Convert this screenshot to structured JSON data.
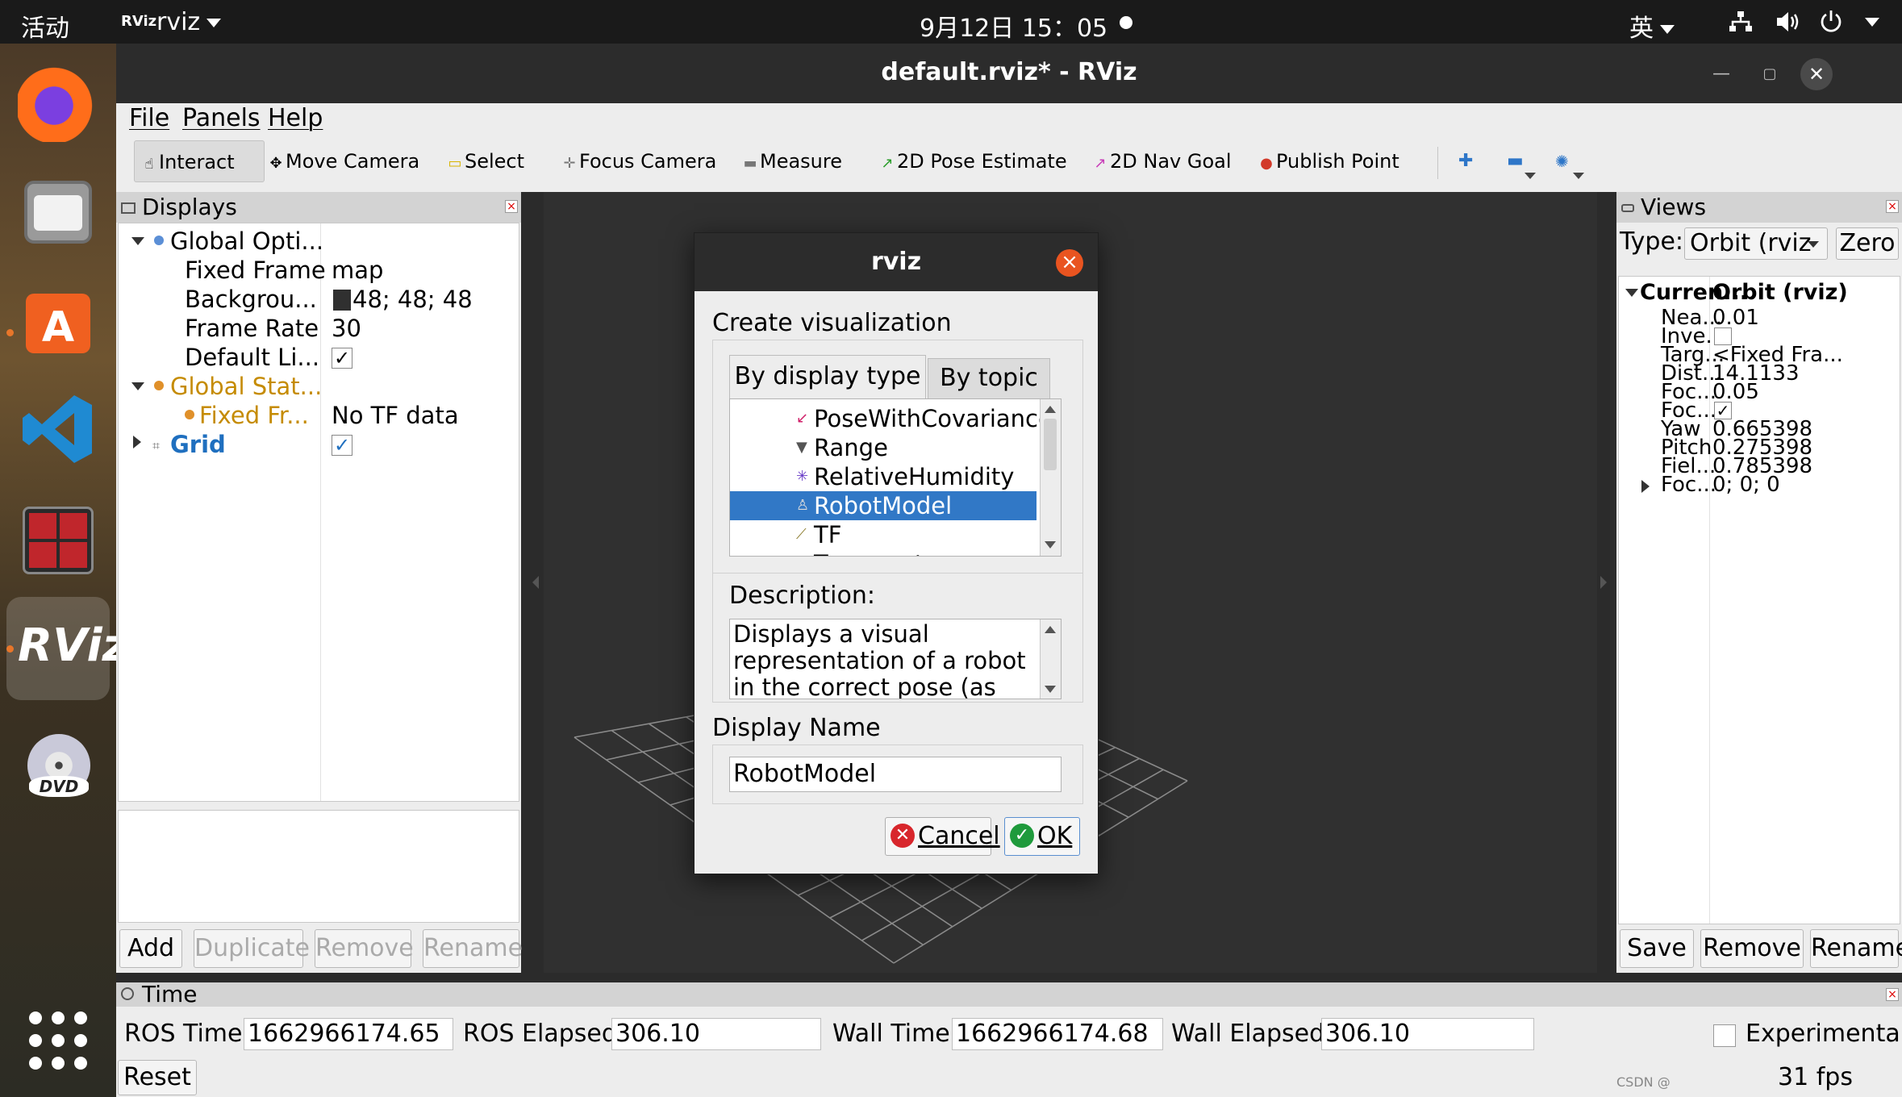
{
  "topbar": {
    "activities": "活动",
    "app_badge": "RViz",
    "app_name": "rviz",
    "clock": "9月12日 15：05",
    "input_method": "英"
  },
  "window": {
    "title": "default.rviz* - RViz"
  },
  "menu": {
    "file": "File",
    "panels": "Panels",
    "help": "Help"
  },
  "toolbar": {
    "interact": "Interact",
    "move_camera": "Move Camera",
    "select": "Select",
    "focus_camera": "Focus Camera",
    "measure": "Measure",
    "pose_estimate": "2D Pose Estimate",
    "nav_goal": "2D Nav Goal",
    "publish_point": "Publish Point"
  },
  "displays": {
    "title": "Displays",
    "global_options": "Global Opti...",
    "fixed_frame_label": "Fixed Frame",
    "fixed_frame_value": "map",
    "background_label": "Backgrou...",
    "background_value": "48; 48; 48",
    "frame_rate_label": "Frame Rate",
    "frame_rate_value": "30",
    "default_light_label": "Default Li...",
    "global_status": "Global Stat...",
    "fixed_fr_label": "Fixed Fr...",
    "fixed_fr_value": "No TF data",
    "grid": "Grid",
    "buttons": {
      "add": "Add",
      "duplicate": "Duplicate",
      "remove": "Remove",
      "rename": "Rename"
    },
    "colors": {
      "warning": "#c58b00",
      "link": "#1f6fbf"
    }
  },
  "views": {
    "title": "Views",
    "type_label": "Type:",
    "type_value": "Orbit (rviz",
    "zero": "Zero",
    "current_label": "Curren...",
    "current_value": "Orbit (rviz)",
    "rows": [
      {
        "k": "Nea...",
        "v": "0.01"
      },
      {
        "k": "Inve...",
        "v": ""
      },
      {
        "k": "Targ...",
        "v": "<Fixed Fra..."
      },
      {
        "k": "Dist...",
        "v": "14.1133"
      },
      {
        "k": "Foc...",
        "v": "0.05"
      },
      {
        "k": "Foc...",
        "v": ""
      },
      {
        "k": "Yaw",
        "v": "0.665398"
      },
      {
        "k": "Pitch",
        "v": "0.275398"
      },
      {
        "k": "Fiel...",
        "v": "0.785398"
      },
      {
        "k": "Foc...",
        "v": "0; 0; 0"
      }
    ],
    "buttons": {
      "save": "Save",
      "remove": "Remove",
      "rename": "Rename"
    }
  },
  "time": {
    "title": "Time",
    "ros_time_label": "ROS Time:",
    "ros_time_value": "1662966174.65",
    "ros_elapsed_label": "ROS Elapsed:",
    "ros_elapsed_value": "306.10",
    "wall_time_label": "Wall Time:",
    "wall_time_value": "1662966174.68",
    "wall_elapsed_label": "Wall Elapsed:",
    "wall_elapsed_value": "306.10",
    "experimental": "Experimental",
    "reset": "Reset",
    "fps": "31 fps",
    "watermark": "CSDN @"
  },
  "dialog": {
    "title": "rviz",
    "create_label": "Create visualization",
    "tab_display_type": "By display type",
    "tab_topic": "By topic",
    "items": [
      "PoseWithCovariance",
      "Range",
      "RelativeHumidity",
      "RobotModel",
      "TF",
      "Temperature"
    ],
    "selected": "RobotModel",
    "description_label": "Description:",
    "description": "Displays a visual representation of a robot in the correct pose (as defined",
    "display_name_label": "Display Name",
    "display_name_value": "RobotModel",
    "cancel": "Cancel",
    "ok": "OK",
    "colors": {
      "selection": "#3178c6",
      "close": "#e95420"
    }
  }
}
